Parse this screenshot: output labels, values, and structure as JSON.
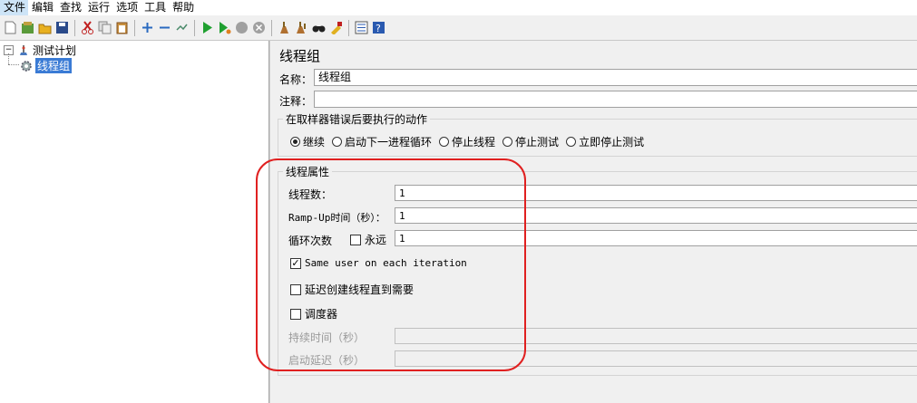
{
  "menu": [
    "文件",
    "编辑",
    "查找",
    "运行",
    "选项",
    "工具",
    "帮助"
  ],
  "toolbar_icons": [
    "new-icon",
    "templates-icon",
    "open-icon",
    "save-icon",
    "cut-icon",
    "copy-icon",
    "paste-icon",
    "expand-icon",
    "collapse-icon",
    "toggle-icon",
    "start-icon",
    "start-no-pause-icon",
    "stop-icon",
    "shutdown-icon",
    "clear-icon",
    "clear-all-icon",
    "search-icon",
    "reset-search-icon",
    "function-helper-icon",
    "help-icon"
  ],
  "tree": {
    "root": "测试计划",
    "child": "线程组"
  },
  "panel": {
    "title": "线程组",
    "name_label": "名称：",
    "name_value": "线程组",
    "comment_label": "注释：",
    "comment_value": "",
    "sampler_error_legend": "在取样器错误后要执行的动作",
    "actions": [
      "继续",
      "启动下一进程循环",
      "停止线程",
      "停止测试",
      "立即停止测试"
    ],
    "selected_action": "继续",
    "props_legend": "线程属性",
    "threads_label": "线程数：",
    "threads_value": "1",
    "rampup_label": "Ramp-Up时间（秒）：",
    "rampup_value": "1",
    "loop_label": "循环次数",
    "forever_label": "永远",
    "loop_value": "1",
    "same_user_label": "Same user on each iteration",
    "same_user_checked": true,
    "delay_label": "延迟创建线程直到需要",
    "delay_checked": false,
    "scheduler_label": "调度器",
    "scheduler_checked": false,
    "duration_label": "持续时间（秒）",
    "startup_delay_label": "启动延迟（秒）"
  },
  "colors": {
    "highlight": "#e02020",
    "selection": "#3a7bd5"
  }
}
